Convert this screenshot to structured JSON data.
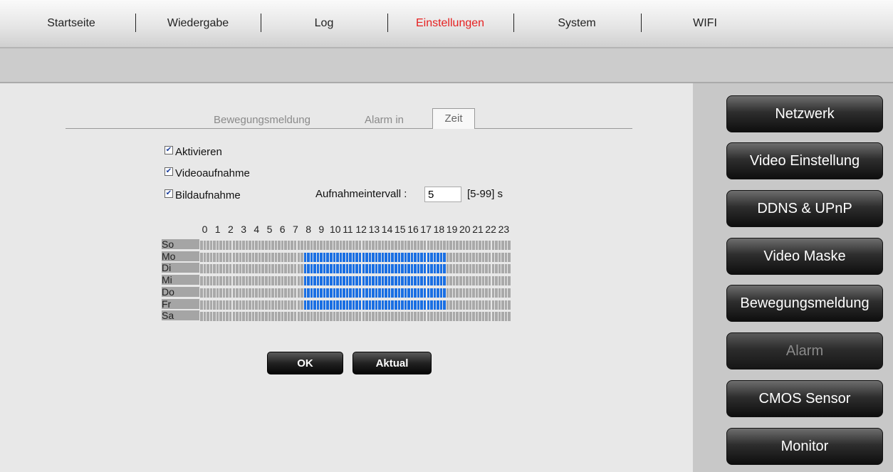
{
  "top_nav": {
    "tabs": [
      {
        "label": "Startseite",
        "active": false
      },
      {
        "label": "Wiedergabe",
        "active": false
      },
      {
        "label": "Log",
        "active": false
      },
      {
        "label": "Einstellungen",
        "active": true
      },
      {
        "label": "System",
        "active": false
      },
      {
        "label": "WIFI",
        "active": false
      }
    ],
    "active_color": "#e62020"
  },
  "sub_tabs": {
    "items": [
      "Bewegungsmeldung",
      "Alarm in"
    ],
    "active": "Zeit"
  },
  "options": {
    "aktivieren": {
      "label": "Aktivieren",
      "checked": true
    },
    "videoaufnahme": {
      "label": "Videoaufnahme",
      "checked": true
    },
    "bildaufnahme": {
      "label": "Bildaufnahme",
      "checked": true
    }
  },
  "interval": {
    "label": "Aufnahmeintervall :",
    "value": "5",
    "range": "[5-99] s"
  },
  "schedule": {
    "hours": [
      "0",
      "1",
      "2",
      "3",
      "4",
      "5",
      "6",
      "7",
      "8",
      "9",
      "10",
      "11",
      "12",
      "13",
      "14",
      "15",
      "16",
      "17",
      "18",
      "19",
      "20",
      "21",
      "22",
      "23"
    ],
    "days": [
      "So",
      "Mo",
      "Di",
      "Mi",
      "Do",
      "Fr",
      "Sa"
    ],
    "slots_per_hour": 4,
    "active_days": [
      "Mo",
      "Di",
      "Mi",
      "Do",
      "Fr"
    ],
    "active_from_hour": 8,
    "active_to_hour": 19,
    "active_color": "#1a6fe3",
    "inactive_color": "#a9a9a9"
  },
  "buttons": {
    "ok": "OK",
    "aktual": "Aktual"
  },
  "right_menu": [
    {
      "label": "Netzwerk",
      "dim": false,
      "icon": "none"
    },
    {
      "label": "Video Einstellung",
      "dim": false,
      "icon": "none"
    },
    {
      "label": "DDNS & UPnP",
      "dim": false,
      "icon": "none"
    },
    {
      "label": "Video Maske",
      "dim": false,
      "icon": "none"
    },
    {
      "label": "Bewegungsmeldung",
      "dim": false,
      "icon": "none"
    },
    {
      "label": "Alarm",
      "dim": true,
      "icon": "none"
    },
    {
      "label": "CMOS Sensor",
      "dim": false,
      "icon": "none"
    },
    {
      "label": "Monitor",
      "dim": false,
      "icon": "none"
    }
  ]
}
